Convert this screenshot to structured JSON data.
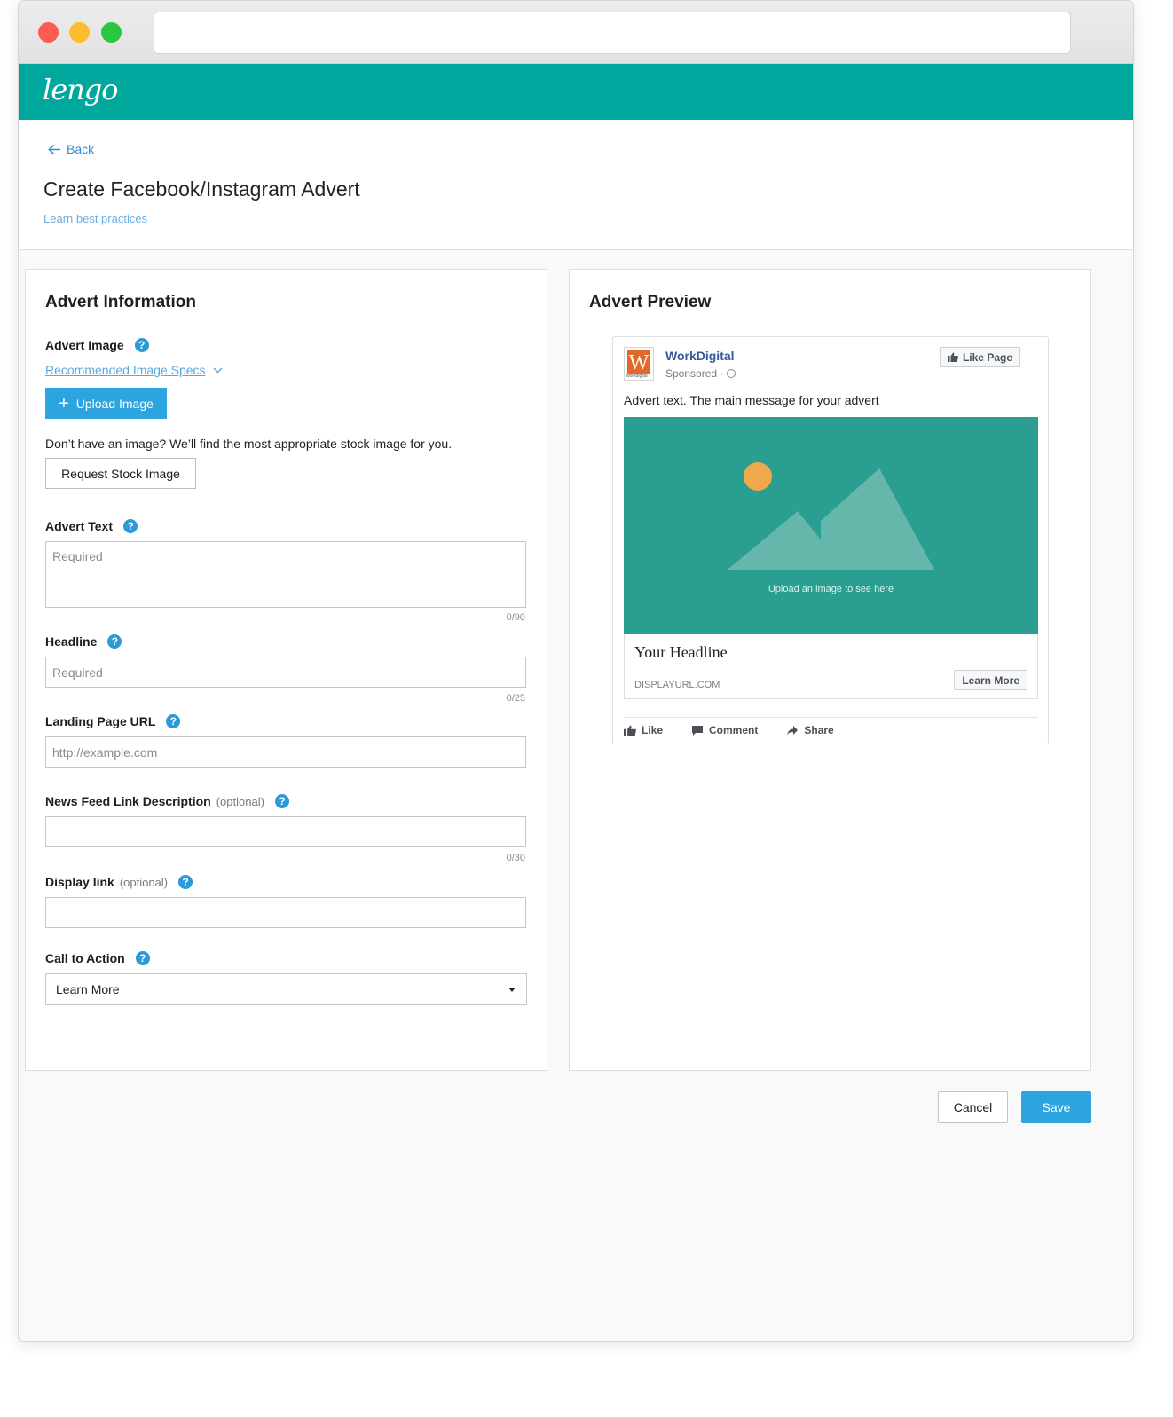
{
  "app": {
    "logo_text": "lengo",
    "brand_color": "#00a79d",
    "accent_color": "#2ba4df"
  },
  "header": {
    "back_label": "Back",
    "title": "Create Facebook/Instagram Advert",
    "best_practices_link": "Learn best practices"
  },
  "form": {
    "title": "Advert Information",
    "image": {
      "label": "Advert Image",
      "specs_link": "Recommended Image Specs",
      "upload_button": "Upload Image",
      "hint": "Don’t have an image? We’ll find the most appropriate stock image for you.",
      "stock_button": "Request Stock Image"
    },
    "advert_text": {
      "label": "Advert Text",
      "placeholder": "Required",
      "value": "",
      "counter": "0/90"
    },
    "headline": {
      "label": "Headline",
      "placeholder": "Required",
      "value": "",
      "counter": "0/25"
    },
    "landing_url": {
      "label": "Landing Page URL",
      "placeholder": "http://example.com",
      "value": ""
    },
    "news_feed_desc": {
      "label": "News Feed Link Description",
      "optional": "(optional)",
      "value": "",
      "counter": "0/30"
    },
    "display_link": {
      "label": "Display link",
      "optional": "(optional)",
      "value": ""
    },
    "cta": {
      "label": "Call to Action",
      "selected": "Learn More"
    },
    "help_glyph": "?"
  },
  "preview": {
    "title": "Advert Preview",
    "page_name": "WorkDigital",
    "logo_letter": "W",
    "logo_sub": "workdigital",
    "sponsored": "Sponsored ·",
    "like_page": "Like Page",
    "advert_text": "Advert text. The main message for your advert",
    "image_caption": "Upload an image to see here",
    "headline": "Your Headline",
    "display_url": "DISPLAYURL.COM",
    "cta_button": "Learn More",
    "actions": {
      "like": "Like",
      "comment": "Comment",
      "share": "Share"
    }
  },
  "footer": {
    "cancel": "Cancel",
    "save": "Save"
  }
}
